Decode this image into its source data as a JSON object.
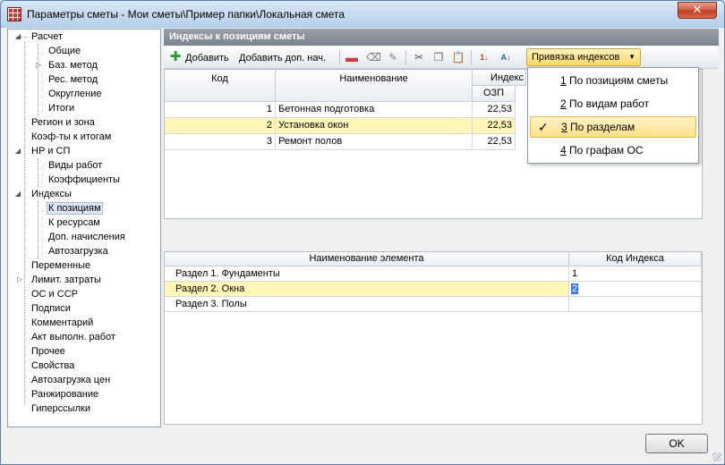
{
  "window": {
    "title": "Параметры сметы - Мои сметы\\Пример папки\\Локальная смета",
    "close_label": "✕"
  },
  "tree": {
    "items": [
      {
        "label": "Расчет",
        "level": 0,
        "expanded": true
      },
      {
        "label": "Общие",
        "level": 1
      },
      {
        "label": "Баз. метод",
        "level": 1,
        "collapsed": true
      },
      {
        "label": "Рес. метод",
        "level": 1
      },
      {
        "label": "Округление",
        "level": 1
      },
      {
        "label": "Итоги",
        "level": 1
      },
      {
        "label": "Регион и зона",
        "level": 0
      },
      {
        "label": "Коэф-ты к итогам",
        "level": 0
      },
      {
        "label": "НР и СП",
        "level": 0,
        "expanded": true
      },
      {
        "label": "Виды работ",
        "level": 1
      },
      {
        "label": "Коэффициенты",
        "level": 1
      },
      {
        "label": "Индексы",
        "level": 0,
        "expanded": true
      },
      {
        "label": "К позициям",
        "level": 1,
        "selected": true
      },
      {
        "label": "К ресурсам",
        "level": 1
      },
      {
        "label": "Доп. начисления",
        "level": 1
      },
      {
        "label": "Автозагрузка",
        "level": 1
      },
      {
        "label": "Переменные",
        "level": 0
      },
      {
        "label": "Лимит. затраты",
        "level": 0,
        "collapsed": true
      },
      {
        "label": "ОС и ССР",
        "level": 0
      },
      {
        "label": "Подписи",
        "level": 0
      },
      {
        "label": "Комментарий",
        "level": 0
      },
      {
        "label": "Акт выполн. работ",
        "level": 0
      },
      {
        "label": "Прочее",
        "level": 0
      },
      {
        "label": "Свойства",
        "level": 0
      },
      {
        "label": "Автозагрузка цен",
        "level": 0
      },
      {
        "label": "Ранжирование",
        "level": 0
      },
      {
        "label": "Гиперссылки",
        "level": 0
      }
    ]
  },
  "panel": {
    "header": "Индексы к позициям сметы"
  },
  "toolbar": {
    "add_label": "Добавить",
    "add_extra_label": "Добавить доп. нач.",
    "binding_label": "Привязка индексов"
  },
  "top_grid": {
    "col_code": "Код",
    "col_name": "Наименование",
    "col_index": "Индекс",
    "col_ozp": "ОЗП",
    "rows": [
      {
        "code": "1",
        "name": "Бетонная подготовка",
        "ozp": "22,53",
        "highlight": false
      },
      {
        "code": "2",
        "name": "Установка окон",
        "ozp": "22,53",
        "highlight": true
      },
      {
        "code": "3",
        "name": "Ремонт полов",
        "ozp": "22,53",
        "highlight": false
      }
    ]
  },
  "menu": {
    "items": [
      {
        "key": "1",
        "text": " По позициям сметы",
        "checked": false
      },
      {
        "key": "2",
        "text": " По видам работ",
        "checked": false
      },
      {
        "key": "3",
        "text": " По разделам",
        "checked": true
      },
      {
        "key": "4",
        "text": " По графам ОС",
        "checked": false
      }
    ]
  },
  "bottom_grid": {
    "col_name": "Наименование элемента",
    "col_code": "Код Индекса",
    "rows": [
      {
        "name": "Раздел 1. Фундаменты",
        "code": "1",
        "highlight": false
      },
      {
        "name": "Раздел 2. Окна",
        "code": "2",
        "highlight": true
      },
      {
        "name": "Раздел 3. Полы",
        "code": "",
        "highlight": false
      }
    ]
  },
  "footer": {
    "ok_label": "OK"
  }
}
